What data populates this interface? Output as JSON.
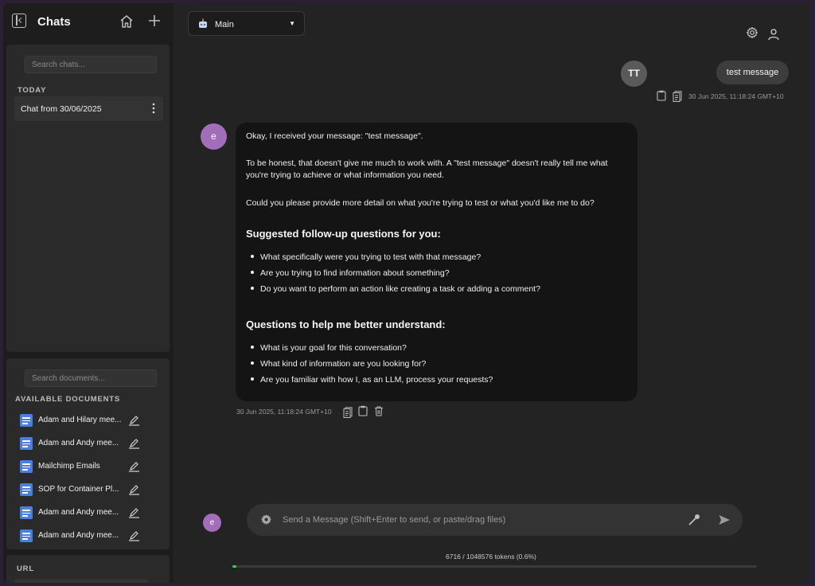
{
  "sidebar": {
    "title": "Chats",
    "chat_search_placeholder": "Search chats...",
    "today_label": "TODAY",
    "chats": [
      {
        "label": "Chat from 30/06/2025"
      }
    ],
    "doc_search_placeholder": "Search documents...",
    "documents_label": "AVAILABLE DOCUMENTS",
    "documents": [
      {
        "name": "Adam and Hilary mee..."
      },
      {
        "name": "Adam and Andy mee..."
      },
      {
        "name": "Mailchimp Emails"
      },
      {
        "name": "SOP for Container Pl..."
      },
      {
        "name": "Adam and Andy mee..."
      },
      {
        "name": "Adam and Andy mee..."
      }
    ],
    "url_label": "URL"
  },
  "header": {
    "model": "Main",
    "model_icon": "robot-icon",
    "icons": [
      "gear-icon",
      "user-icon"
    ]
  },
  "conversation": {
    "user_message": {
      "avatar": "TT",
      "text": "test message",
      "timestamp": "30 Jun 2025, 11:18:24 GMT+10"
    },
    "bot_message": {
      "avatar": "e",
      "p1": "Okay, I received your message: \"test message\".",
      "p2": "To be honest, that doesn't give me much to work with. A \"test message\" doesn't really tell me what you're trying to achieve or what information you need.",
      "p3": "Could you please provide more detail on what you're trying to test or what you'd like me to do?",
      "h1": "Suggested follow-up questions for you:",
      "list1": [
        "What specifically were you trying to test with that message?",
        "Are you trying to find information about something?",
        "Do you want to perform an action like creating a task or adding a comment?"
      ],
      "h2": "Questions to help me better understand:",
      "list2": [
        "What is your goal for this conversation?",
        "What kind of information are you looking for?",
        "Are you familiar with how I, as an LLM, process your requests?"
      ],
      "timestamp": "30 Jun 2025, 11:18:24 GMT+10"
    }
  },
  "composer": {
    "avatar": "e",
    "placeholder": "Send a Message (Shift+Enter to send, or paste/drag files)"
  },
  "usage": {
    "tokens_text": "6716 / 1048576 tokens (0.6%)",
    "fraction": 0.006,
    "accent": "#3fd13f"
  },
  "colors": {
    "bot_avatar": "#a26eb9",
    "doc_icon": "#4a7fe0"
  }
}
